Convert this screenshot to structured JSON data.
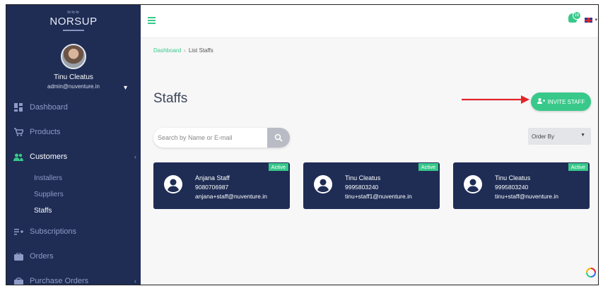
{
  "brand": {
    "logo_text": "NORSUP"
  },
  "user": {
    "name": "Tinu Cleatus",
    "email": "admin@nuventure.in"
  },
  "sidebar": {
    "items": [
      {
        "label": "Dashboard",
        "icon": "dashboard-icon"
      },
      {
        "label": "Products",
        "icon": "cart-icon"
      },
      {
        "label": "Customers",
        "icon": "customers-icon",
        "active": true
      },
      {
        "label": "Subscriptions",
        "icon": "subscriptions-icon"
      },
      {
        "label": "Orders",
        "icon": "orders-icon"
      },
      {
        "label": "Purchase Orders",
        "icon": "purchase-orders-icon"
      }
    ],
    "sub_items": [
      {
        "label": "Installers"
      },
      {
        "label": "Suppliers"
      },
      {
        "label": "Staffs",
        "active": true
      }
    ]
  },
  "header": {
    "notification_count": "16",
    "language_flag": "uk-flag-icon"
  },
  "breadcrumb": {
    "home": "Dashboard",
    "separator": "›",
    "current": "List Staffs"
  },
  "page": {
    "title": "Staffs",
    "invite_button": "INVITE STAFF",
    "search_placeholder": "Search by Name or E-mail",
    "order_by_label": "Order By"
  },
  "staff": [
    {
      "name": "Anjana Staff",
      "phone": "9080706987",
      "email": "anjana+staff@nuventure.in",
      "status": "Active"
    },
    {
      "name": "Tinu Cleatus",
      "phone": "9995803240",
      "email": "tinu+staff1@nuventure.in",
      "status": "Active"
    },
    {
      "name": "Tinu Cleatus",
      "phone": "9995803240",
      "email": "tinu+staff@nuventure.in",
      "status": "Active"
    }
  ],
  "colors": {
    "sidebar": "#1f2d55",
    "accent": "#38c98a",
    "card": "#1f2d55"
  }
}
